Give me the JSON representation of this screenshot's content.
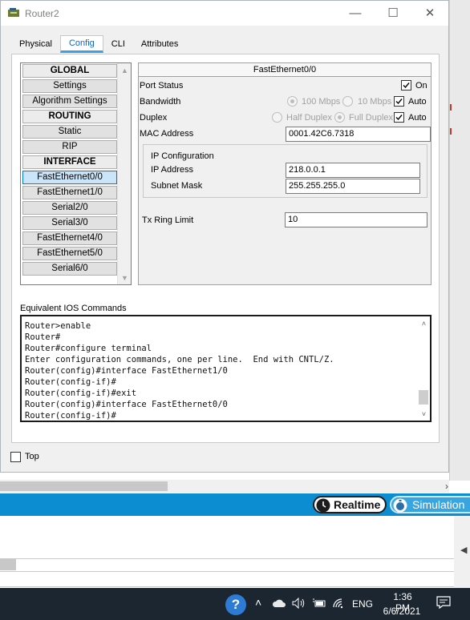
{
  "window": {
    "title": "Router2",
    "controls": {
      "minimize": "—",
      "maximize": "☐",
      "close": "✕"
    }
  },
  "tabs": [
    {
      "label": "Physical",
      "active": false
    },
    {
      "label": "Config",
      "active": true
    },
    {
      "label": "CLI",
      "active": false
    },
    {
      "label": "Attributes",
      "active": false
    }
  ],
  "nav": {
    "items": [
      {
        "label": "GLOBAL",
        "type": "header"
      },
      {
        "label": "Settings",
        "type": "item"
      },
      {
        "label": "Algorithm Settings",
        "type": "item"
      },
      {
        "label": "ROUTING",
        "type": "header"
      },
      {
        "label": "Static",
        "type": "item"
      },
      {
        "label": "RIP",
        "type": "item"
      },
      {
        "label": "INTERFACE",
        "type": "header"
      },
      {
        "label": "FastEthernet0/0",
        "type": "item",
        "selected": true
      },
      {
        "label": "FastEthernet1/0",
        "type": "item"
      },
      {
        "label": "Serial2/0",
        "type": "item"
      },
      {
        "label": "Serial3/0",
        "type": "item"
      },
      {
        "label": "FastEthernet4/0",
        "type": "item"
      },
      {
        "label": "FastEthernet5/0",
        "type": "item"
      },
      {
        "label": "Serial6/0",
        "type": "item"
      }
    ]
  },
  "config": {
    "title": "FastEthernet0/0",
    "port_status": {
      "label": "Port Status",
      "on_label": "On",
      "checked": true
    },
    "bandwidth": {
      "label": "Bandwidth",
      "opt1": "100 Mbps",
      "opt2": "10 Mbps",
      "auto_label": "Auto",
      "auto_checked": true
    },
    "duplex": {
      "label": "Duplex",
      "opt1": "Half Duplex",
      "opt2": "Full Duplex",
      "auto_label": "Auto",
      "auto_checked": true
    },
    "mac": {
      "label": "MAC Address",
      "value": "0001.42C6.7318"
    },
    "ip_config": {
      "title": "IP Configuration",
      "ip_label": "IP Address",
      "ip_value": "218.0.0.1",
      "mask_label": "Subnet Mask",
      "mask_value": "255.255.255.0"
    },
    "tx_ring": {
      "label": "Tx Ring Limit",
      "value": "10"
    }
  },
  "ios": {
    "label": "Equivalent IOS Commands",
    "text": "Router>enable\nRouter#\nRouter#configure terminal\nEnter configuration commands, one per line.  End with CNTL/Z.\nRouter(config)#interface FastEthernet1/0\nRouter(config-if)#\nRouter(config-if)#exit\nRouter(config)#interface FastEthernet0/0\nRouter(config-if)#"
  },
  "top_checkbox": {
    "label": "Top",
    "checked": false
  },
  "workspace": {
    "realtime_label": "Realtime",
    "simulation_label": "Simulation"
  },
  "taskbar": {
    "language": "ENG",
    "time": "1:36 PM",
    "date": "6/6/2021"
  },
  "colors": {
    "accent_blue": "#0c8dd1",
    "selected_nav": "#cce4f7",
    "taskbar": "#1b2631"
  }
}
